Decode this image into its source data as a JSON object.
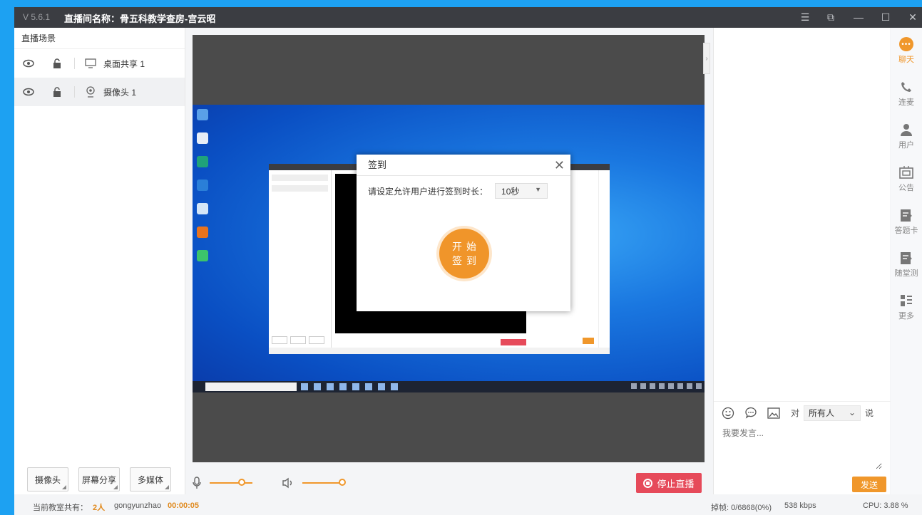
{
  "window": {
    "version": "V 5.6.1",
    "title": "直播间名称：骨五科教学查房-宫云昭",
    "controls": [
      "☰",
      "⧉",
      "—",
      "☐",
      "✕"
    ]
  },
  "scenes": {
    "header": "直播场景",
    "items": [
      {
        "label": "桌面共享 1",
        "icon": "monitor-icon"
      },
      {
        "label": "摄像头 1",
        "icon": "camera-icon"
      }
    ]
  },
  "left_buttons": [
    "摄像头",
    "屏幕分享",
    "多媒体"
  ],
  "signin_dialog": {
    "title": "签到",
    "prompt": "请设定允许用户进行签到时长：",
    "duration": "10秒",
    "start_line1": "开始",
    "start_line2": "签到"
  },
  "controls": {
    "mic_level": 0.75,
    "volume_level": 1.0,
    "stop_label": "停止直播"
  },
  "chat": {
    "to_label": "对",
    "recipient": "所有人",
    "say_label": "说",
    "placeholder": "我要发言...",
    "send_label": "发送"
  },
  "rail": [
    {
      "label": "聊天",
      "icon": "chat-icon",
      "active": true
    },
    {
      "label": "连麦",
      "icon": "phone-icon",
      "active": false
    },
    {
      "label": "用户",
      "icon": "user-icon",
      "active": false
    },
    {
      "label": "公告",
      "icon": "notice-icon",
      "active": false
    },
    {
      "label": "答题卡",
      "icon": "answer-card-icon",
      "active": false
    },
    {
      "label": "随堂测",
      "icon": "quiz-icon",
      "active": false
    },
    {
      "label": "更多",
      "icon": "more-icon",
      "active": false
    }
  ],
  "status": {
    "online_label": "当前教室共有：",
    "online_count": "2人",
    "username": "gongyunzhao",
    "elapsed": "00:00:05",
    "frames": "掉帧: 0/6868(0%)",
    "bitrate": "538 kbps",
    "cpu": "CPU: 3.88 %"
  },
  "colors": {
    "accent": "#f0972b",
    "stop": "#e64a5a",
    "titlebar": "#3b3d42"
  }
}
